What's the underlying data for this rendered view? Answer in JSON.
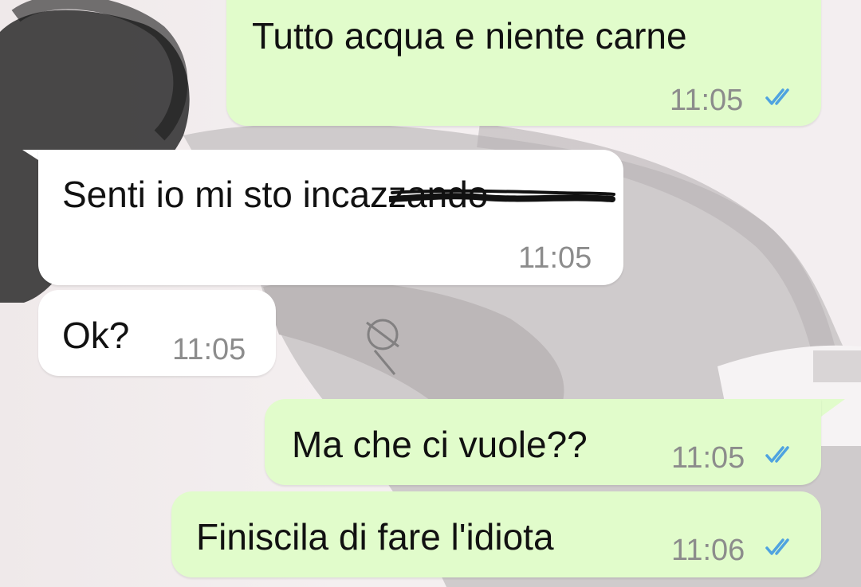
{
  "chat": {
    "messages": [
      {
        "direction": "out",
        "text": "Tutto acqua e niente carne",
        "time": "11:05",
        "status": "read"
      },
      {
        "direction": "in",
        "text": "Senti io mi sto incazzando",
        "time": "11:05",
        "strikethrough_part": "cazzando"
      },
      {
        "direction": "in",
        "text": "Ok?",
        "time": "11:05"
      },
      {
        "direction": "out",
        "text": "Ma che ci vuole??",
        "time": "11:05",
        "status": "read"
      },
      {
        "direction": "out",
        "text": "Finiscila di fare l'idiota",
        "time": "11:06",
        "status": "read"
      }
    ]
  },
  "colors": {
    "outgoing_bubble": "#e1fccb",
    "incoming_bubble": "#ffffff",
    "read_ticks": "#4fa3e0",
    "timestamp": "#8c8c8c",
    "text": "#111111"
  },
  "icons": {
    "read_receipt": "double-check-icon"
  }
}
